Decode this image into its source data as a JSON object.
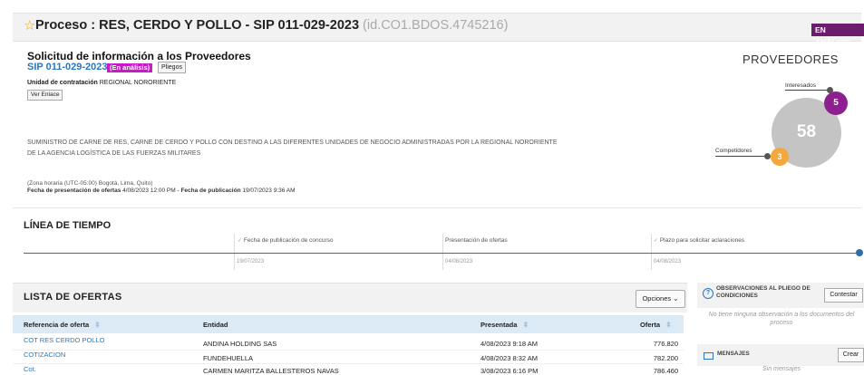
{
  "header": {
    "star_icon": "star-icon",
    "title": "Proceso : RES, CERDO Y POLLO - SIP 011-029-2023",
    "id_text": "(id.CO1.BDOS.4745216)",
    "status": "EN ANÁLISIS"
  },
  "request": {
    "title": "Solicitud de información a los Proveedores",
    "code": "SIP 011-029-2023",
    "badge": "(En análisis)",
    "pliegos_label": "Pliegos",
    "unit_label": "Unidad de contratación",
    "unit_value": "REGIONAL NORORIENTE",
    "ver_enlace": "Ver Enlace",
    "description_line1": "SUMINISTRO DE CARNE DE RES, CARNE DE CERDO Y POLLO CON DESTINO A LAS DIFERENTES UNIDADES DE NEGOCIO ADMINISTRADAS POR LA REGIONAL NORORIENTE",
    "description_line2": "DE LA AGENCIA LOGÍSTICA DE LAS FUERZAS MILITARES",
    "timezone": "(Zona horaria (UTC-05:00) Bogotá, Lima, Quito)",
    "offers_date_label": "Fecha de presentación de ofertas",
    "offers_date_value": "4/08/2023 12:00 PM -",
    "pub_date_label": "Fecha de publicación",
    "pub_date_value": "19/07/2023 9:36 AM"
  },
  "providers": {
    "title": "PROVEEDORES",
    "interested_label": "Interesados",
    "interested_count": "5",
    "total": "58",
    "competitors_label": "Competidores",
    "competitors_count": "3"
  },
  "timeline": {
    "title": "LÍNEA DE TIEMPO",
    "check_mark": "✓",
    "events": [
      {
        "label": "Fecha de publicación de concurso",
        "date": "19/07/2023",
        "checked": true
      },
      {
        "label": "Presentación de ofertas",
        "date": "04/08/2023",
        "checked": false
      },
      {
        "label": "Plazo para solicitar aclaraciones",
        "date": "04/08/2023",
        "checked": true
      }
    ]
  },
  "offers": {
    "title": "LISTA DE OFERTAS",
    "options_label": "Opciones",
    "columns": [
      "Referencia de oferta",
      "Entidad",
      "Presentada",
      "Oferta"
    ],
    "rows": [
      {
        "ref": "COT RES CERDO POLLO",
        "entity": "ANDINA HOLDING SAS",
        "presented": "4/08/2023 9:18 AM",
        "offer": "776.820"
      },
      {
        "ref": "COTIZACION",
        "entity": "FUNDEHUELLA",
        "presented": "4/08/2023 8:32 AM",
        "offer": "782.200"
      },
      {
        "ref": "Cot.",
        "entity": "CARMEN MARITZA BALLESTEROS NAVAS",
        "presented": "3/08/2023 6:16 PM",
        "offer": "786.460"
      }
    ]
  },
  "observations": {
    "title_line1": "OBSERVACIONES AL PLIEGO DE",
    "title_line2": "CONDICIONES",
    "answer_label": "Contestar",
    "empty_line1": "No tiene ninguna observación a los documentos del",
    "empty_line2": "proceso"
  },
  "messages": {
    "title": "MENSAJES",
    "create_label": "Crear",
    "empty": "Sin mensajes"
  },
  "colors": {
    "status_bg": "#6d1b6d",
    "link": "#2a76bf",
    "interested": "#8e1f8e",
    "competitors": "#f4a73a",
    "total": "#c4c4c4"
  }
}
